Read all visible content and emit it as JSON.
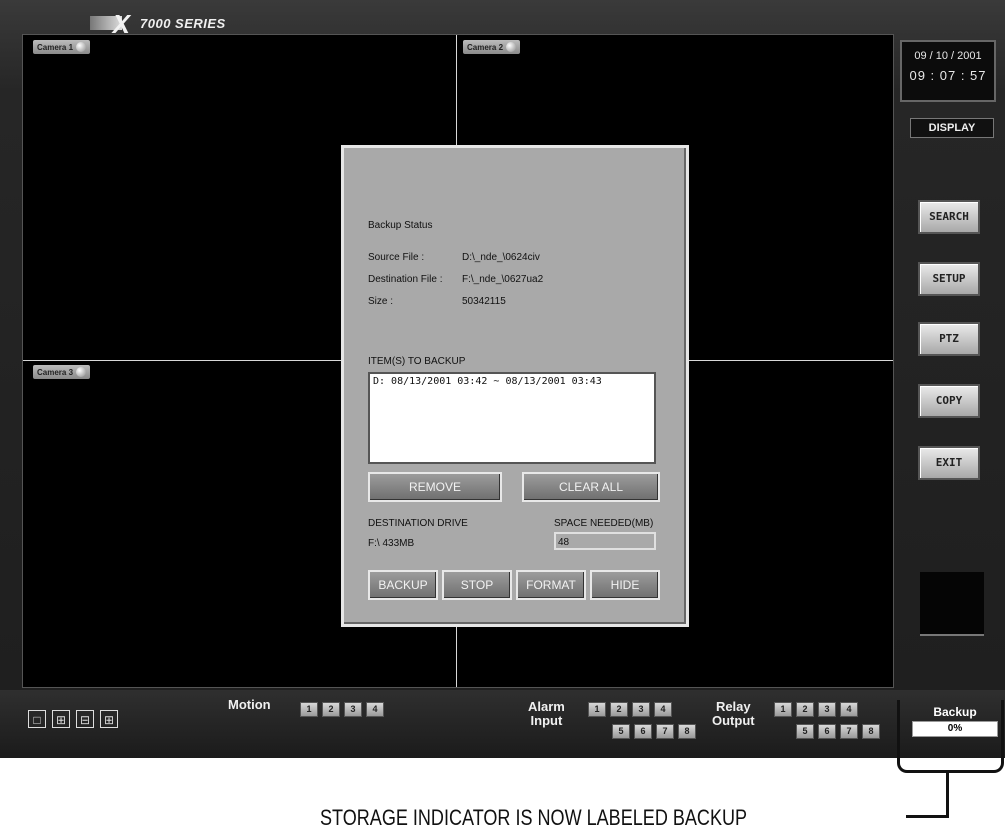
{
  "brand": {
    "series": "7000 SERIES"
  },
  "cameras": [
    {
      "label": "Camera 1"
    },
    {
      "label": "Camera 2"
    },
    {
      "label": "Camera 3"
    }
  ],
  "clock": {
    "date": "09 / 10 / 2001",
    "time": "09 : 07 : 57"
  },
  "side_panel": {
    "display_label": "DISPLAY",
    "buttons": [
      {
        "label": "SEARCH"
      },
      {
        "label": "SETUP"
      },
      {
        "label": "PTZ"
      },
      {
        "label": "COPY"
      },
      {
        "label": "EXIT"
      }
    ]
  },
  "dialog": {
    "title": "Backup Status",
    "source_label": "Source File :",
    "source_value": "D:\\_nde_\\0624civ",
    "destination_label": "Destination File :",
    "destination_value": "F:\\_nde_\\0627ua2",
    "size_label": "Size :",
    "size_value": "50342115",
    "items_label": "ITEM(S) TO BACKUP",
    "items": [
      "D: 08/13/2001 03:42 ~ 08/13/2001 03:43"
    ],
    "remove_label": "REMOVE",
    "clear_all_label": "CLEAR ALL",
    "dest_drive_label": "DESTINATION DRIVE",
    "dest_drive_value": "F:\\ 433MB",
    "space_needed_label": "SPACE NEEDED(MB)",
    "space_needed_value": "48",
    "backup_label": "BACKUP",
    "stop_label": "STOP",
    "format_label": "FORMAT",
    "hide_label": "HIDE"
  },
  "bottom": {
    "layout_icons": [
      "single-view-icon",
      "quad-view-icon",
      "split-view-icon",
      "full-grid-icon"
    ],
    "motion_label": "Motion",
    "motion_channels": [
      "1",
      "2",
      "3",
      "4"
    ],
    "alarm_label_1": "Alarm",
    "alarm_label_2": "Input",
    "alarm_channels_row1": [
      "1",
      "2",
      "3",
      "4"
    ],
    "alarm_channels_row2": [
      "5",
      "6",
      "7",
      "8"
    ],
    "relay_label_1": "Relay",
    "relay_label_2": "Output",
    "relay_channels_row1": [
      "1",
      "2",
      "3",
      "4"
    ],
    "relay_channels_row2": [
      "5",
      "6",
      "7",
      "8"
    ],
    "backup_label": "Backup",
    "backup_progress": "0%"
  },
  "caption": "STORAGE INDICATOR IS NOW LABELED BACKUP"
}
